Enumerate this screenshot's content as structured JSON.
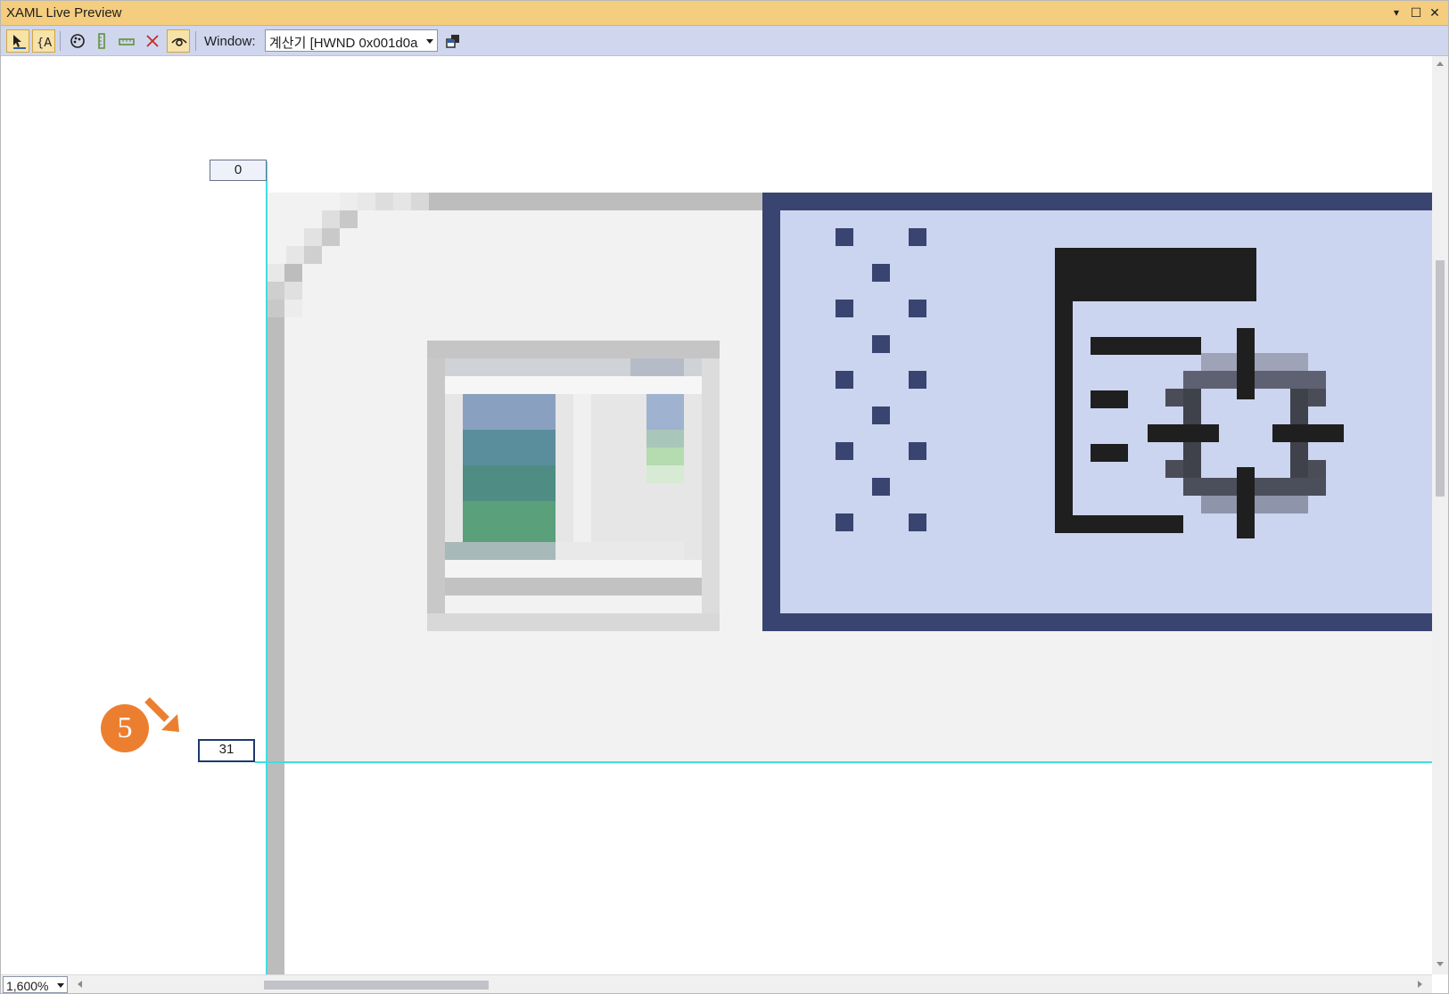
{
  "window": {
    "title": "XAML Live Preview",
    "controls": {
      "dropdown": "▾",
      "maximize": "☐",
      "close": "✕"
    }
  },
  "toolbar": {
    "buttons": [
      {
        "icon": "select-element-icon",
        "active": true
      },
      {
        "icon": "display-layout-adorners-icon",
        "active": true
      },
      {
        "icon": "track-focused-element-icon",
        "active": false
      },
      {
        "icon": "vertical-ruler-icon",
        "active": false
      },
      {
        "icon": "horizontal-ruler-icon",
        "active": false
      },
      {
        "icon": "clear-rulers-icon",
        "active": false
      },
      {
        "icon": "preview-selection-icon",
        "active": true
      }
    ],
    "window_label": "Window:",
    "window_value": "계산기 [HWND 0x001d0a",
    "pin_icon": "attach-window-icon"
  },
  "rulers": {
    "top_value": "0",
    "bottom_value": "31"
  },
  "callout": {
    "number": "5"
  },
  "zoom": {
    "value": "1,600%"
  },
  "colors": {
    "title_bar": "#f5cd7f",
    "toolbar": "#cfd6ed",
    "guide": "#3fdede",
    "icon_frame": "#3a4470",
    "icon_fill": "#ccd5ef",
    "callout": "#ec7f2f"
  }
}
